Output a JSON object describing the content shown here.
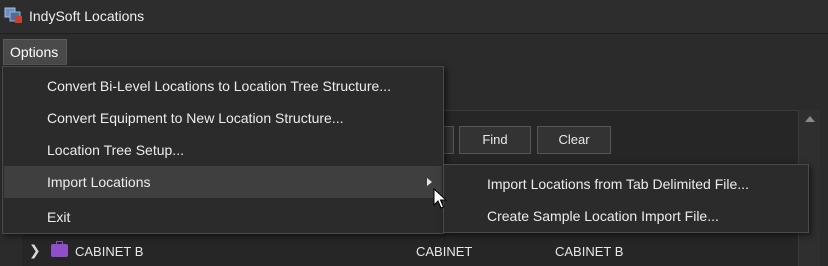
{
  "window": {
    "title": "IndySoft Locations",
    "icon": "indysoft-app-icon"
  },
  "menubar": {
    "options_label": "Options"
  },
  "options_menu": {
    "items": [
      {
        "label": "Convert Bi-Level Locations to Location Tree Structure..."
      },
      {
        "label": "Convert Equipment to New Location Structure..."
      },
      {
        "label": "Location Tree Setup..."
      },
      {
        "label": "Import Locations",
        "has_submenu": true,
        "highlighted": true
      },
      {
        "label": "Exit"
      }
    ]
  },
  "import_submenu": {
    "items": [
      {
        "label": "Import Locations from Tab Delimited File..."
      },
      {
        "label": "Create Sample Location Import File..."
      }
    ]
  },
  "toolbar": {
    "find_label": "Find",
    "clear_label": "Clear"
  },
  "grid": {
    "rows": [
      {
        "name": "CABINET B",
        "type": "CABINET",
        "description": "CABINET B",
        "icon": "briefcase-icon"
      }
    ]
  },
  "colors": {
    "accent_highlight": "#3f3f3f",
    "cabinet_icon": "#8e4fc8"
  }
}
